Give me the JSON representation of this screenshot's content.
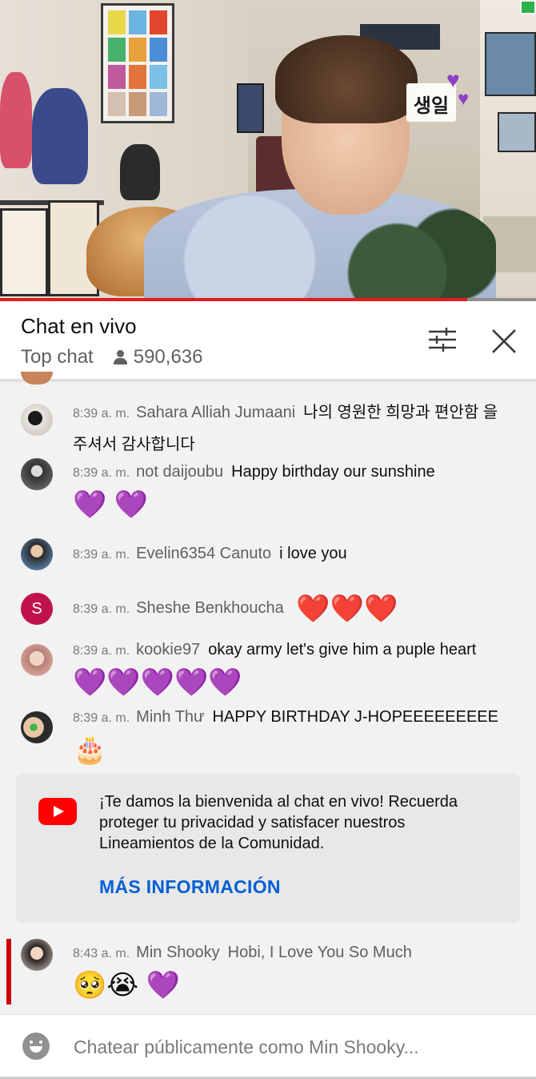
{
  "video": {
    "sign_text": "생일",
    "progress": 0.872
  },
  "chat": {
    "title": "Chat en vivo",
    "mode": "Top chat",
    "viewer_count": "590,636"
  },
  "messages": [
    {
      "time": "8:39 a. m.",
      "author": "Sahara Alliah Jumaani",
      "text": "나의 영원한 희망과 편안함 을 주셔서 감사합니다",
      "emojis": ""
    },
    {
      "time": "8:39 a. m.",
      "author": "not daijoubu",
      "text": "Happy birthday our sunshine",
      "emojis": "💜 💜"
    },
    {
      "time": "8:39 a. m.",
      "author": "Evelin6354 Canuto",
      "text": "i love you",
      "emojis": ""
    },
    {
      "time": "8:39 a. m.",
      "author": "Sheshe Benkhoucha",
      "text": "",
      "emojis": "❤️❤️❤️",
      "avatar_letter": "S"
    },
    {
      "time": "8:39 a. m.",
      "author": "kookie97",
      "text": "okay army let's give him a puple heart",
      "emojis": "💜💜💜💜💜"
    },
    {
      "time": "8:39 a. m.",
      "author": "Minh Thư",
      "text": "HAPPY BIRTHDAY J-HOPEEEEEEEEE",
      "emojis": "🎂"
    }
  ],
  "welcome": {
    "text": "¡Te damos la bienvenida al chat en vivo! Recuerda proteger tu privacidad y satisfacer nuestros Lineamientos de la Comunidad.",
    "more_info": "MÁS INFORMACIÓN"
  },
  "own_message": {
    "time": "8:43 a. m.",
    "author": "Min Shooky",
    "text": "Hobi, I Love You So Much",
    "emojis": "🥺😭 💜"
  },
  "input": {
    "placeholder": "Chatear públicamente como Min Shooky..."
  },
  "colors": {
    "accent_red": "#cc0000",
    "link_blue": "#065fd4",
    "heart_purple": "#8c3fd1"
  },
  "icons": {
    "filter": "filter-icon",
    "close": "close-icon",
    "viewers": "person-icon",
    "emoji": "emoji-icon",
    "youtube": "youtube-logo-icon"
  }
}
